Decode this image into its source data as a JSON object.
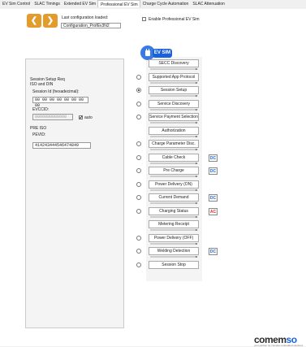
{
  "tabs": [
    {
      "label": "EV Sim Control"
    },
    {
      "label": "SLAC Timings"
    },
    {
      "label": "Extended EV Sim"
    },
    {
      "label": "Professional EV Sim"
    },
    {
      "label": "Charge Cycle Automation"
    },
    {
      "label": "SLAC Attenuation"
    }
  ],
  "active_tab": "Professional EV Sim",
  "config": {
    "last_loaded_label": "Last configuration loaded:",
    "name": "Configuration_ProfEv3N2",
    "enable_label": "Enable Professional EV Sim",
    "enable_checked": false
  },
  "panel": {
    "section_title": "Session Setup Req",
    "iso_din_label": "ISO and DIN",
    "session_id_label": "Session Id (hexadecimal):",
    "session_id_value": "00 00 00 00 00 00 00 00",
    "evccid_label": "EVCCID:",
    "evccid_value": "0000000000000",
    "auto_label": "auto",
    "auto_checked": true,
    "pre_iso_label": "PRE ISO",
    "pevid_label": "PEVID:",
    "pevid_value": "414243444546474849"
  },
  "ev_sim_label": "EV SIM",
  "ev_icon": "ev-plug-icon",
  "steps": [
    {
      "label": "SECC Discovery",
      "radio": false,
      "badge": ""
    },
    {
      "label": "Supported App Protocol",
      "radio": true,
      "badge": ""
    },
    {
      "label": "Session Setup",
      "radio": true,
      "checked": true,
      "badge": ""
    },
    {
      "label": "Service Discovery",
      "radio": true,
      "badge": ""
    },
    {
      "label": "Service Payment Selection",
      "radio": true,
      "badge": ""
    },
    {
      "label": "Authorization",
      "radio": false,
      "badge": ""
    },
    {
      "label": "Charge Parameter Disc.",
      "radio": true,
      "badge": ""
    },
    {
      "label": "Cable Check",
      "radio": true,
      "badge": "DC"
    },
    {
      "label": "Pre Charge",
      "radio": true,
      "badge": "DC"
    },
    {
      "label": "Power Delivery (ON)",
      "radio": true,
      "badge": ""
    },
    {
      "label": "Current Demand",
      "radio": true,
      "badge": "DC"
    },
    {
      "label": "Charging Status",
      "radio": true,
      "badge": "AC"
    },
    {
      "label": "Metering Receipt",
      "radio": false,
      "badge": ""
    },
    {
      "label": "Power Delivery (OFF)",
      "radio": true,
      "badge": ""
    },
    {
      "label": "Welding Detection",
      "radio": true,
      "badge": "DC"
    },
    {
      "label": "Session Stop",
      "radio": true,
      "badge": ""
    }
  ],
  "colors": {
    "accent": "#1a62dc",
    "orange": "#e39b2c",
    "dc": "#1a62dc",
    "ac": "#d0342c"
  },
  "brand": {
    "prefix": "comem",
    "suffix": "so",
    "tagline": "your partner for complex embedded solutions"
  }
}
